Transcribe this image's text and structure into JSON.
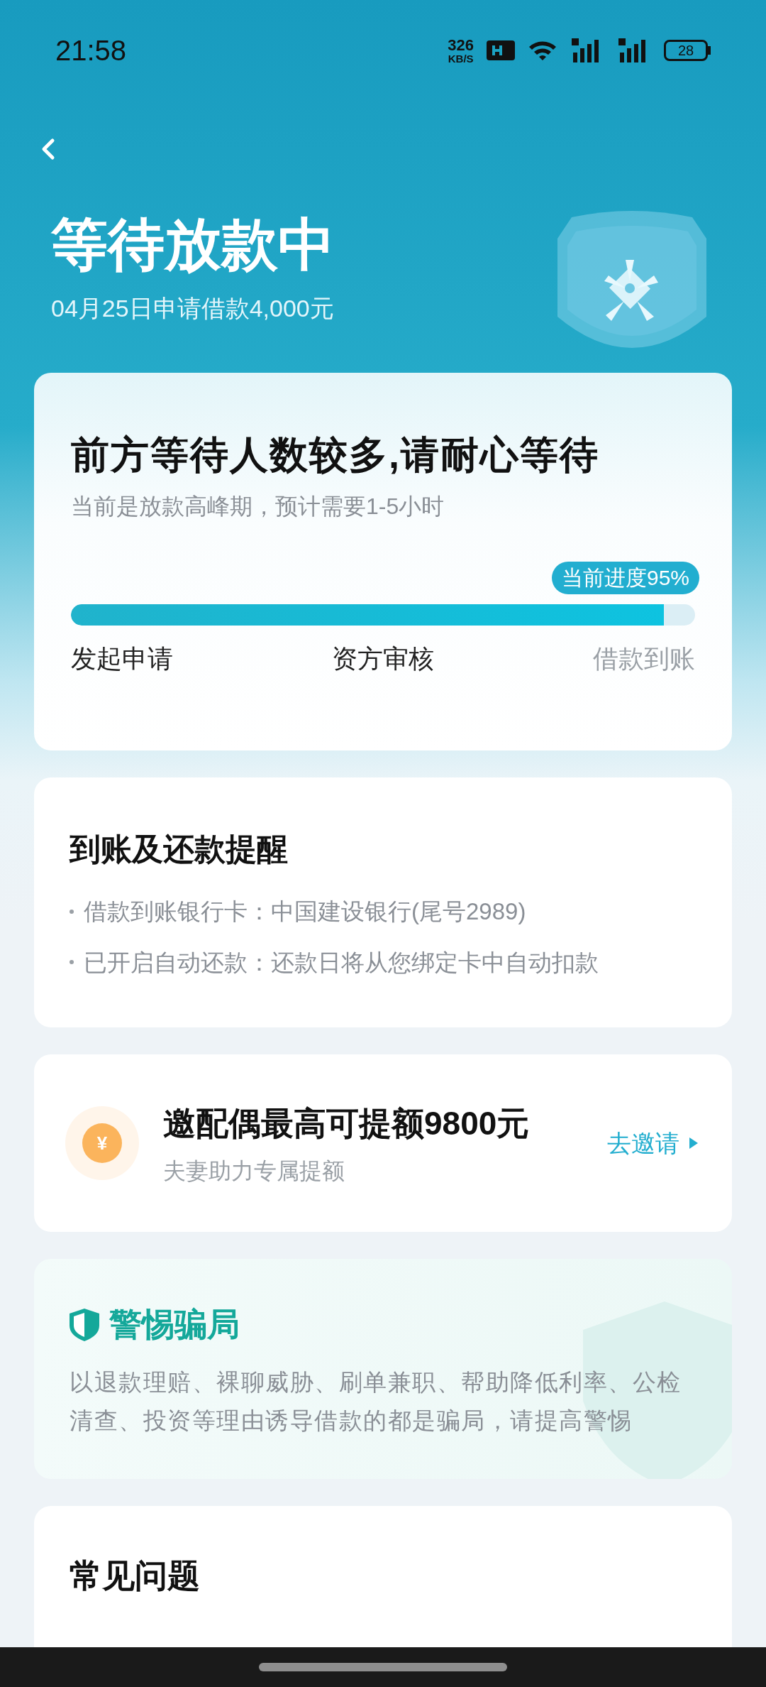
{
  "status_bar": {
    "time": "21:58",
    "speed": "326",
    "speed_unit": "KB/S",
    "battery": "28"
  },
  "header": {
    "title": "等待放款中",
    "subtitle": "04月25日申请借款4,000元"
  },
  "progress_card": {
    "title": "前方等待人数较多,请耐心等待",
    "subtitle": "当前是放款高峰期，预计需要1-5小时",
    "badge": "当前进度95%",
    "level": 0.95,
    "steps": [
      {
        "label": "发起申请",
        "done": true
      },
      {
        "label": "资方审核",
        "done": true
      },
      {
        "label": "借款到账",
        "done": false
      }
    ]
  },
  "reminder_card": {
    "title": "到账及还款提醒",
    "items": [
      "借款到账银行卡：中国建设银行(尾号2989)",
      "已开启自动还款：还款日将从您绑定卡中自动扣款"
    ]
  },
  "invite_card": {
    "icon_text": "¥",
    "title": "邀配偶最高可提额9800元",
    "subtitle": "夫妻助力专属提额",
    "action": "去邀请"
  },
  "fraud_card": {
    "title": "警惕骗局",
    "text": "以退款理赔、裸聊威胁、刷单兼职、帮助降低利率、公检清查、投资等理由诱导借款的都是骗局，请提高警惕"
  },
  "faq_card": {
    "title": "常见问题"
  }
}
